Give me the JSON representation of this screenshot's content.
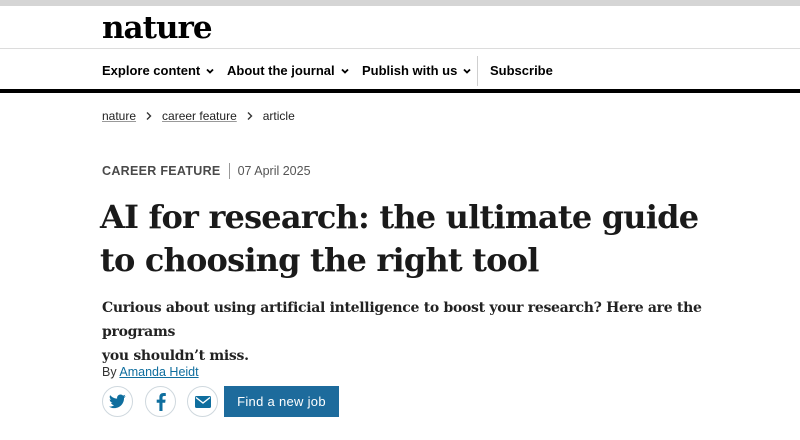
{
  "header": {
    "logo_text": "nature"
  },
  "nav": {
    "items": [
      {
        "label": "Explore content",
        "has_dropdown": true
      },
      {
        "label": "About the journal",
        "has_dropdown": true
      },
      {
        "label": "Publish with us",
        "has_dropdown": true
      },
      {
        "label": "Subscribe",
        "has_dropdown": false
      }
    ]
  },
  "breadcrumb": {
    "items": [
      "nature",
      "career feature",
      "article"
    ]
  },
  "article": {
    "type": "CAREER FEATURE",
    "date": "07 April 2025",
    "title_line1": "AI for research: the ultimate guide",
    "title_line2": "to choosing the right tool",
    "standfirst_line1": "Curious about using artificial intelligence to boost your research? Here are the programs",
    "standfirst_line2": "you shouldn’t miss.",
    "byline_prefix": "By",
    "author": "Amanda Heidt"
  },
  "share": {
    "icons": [
      "twitter-icon",
      "facebook-icon",
      "email-icon"
    ]
  },
  "cta": {
    "label": "Find a new job"
  },
  "colors": {
    "accent": "#1d6b9c",
    "link": "#0f6e9e",
    "text": "#222222"
  }
}
